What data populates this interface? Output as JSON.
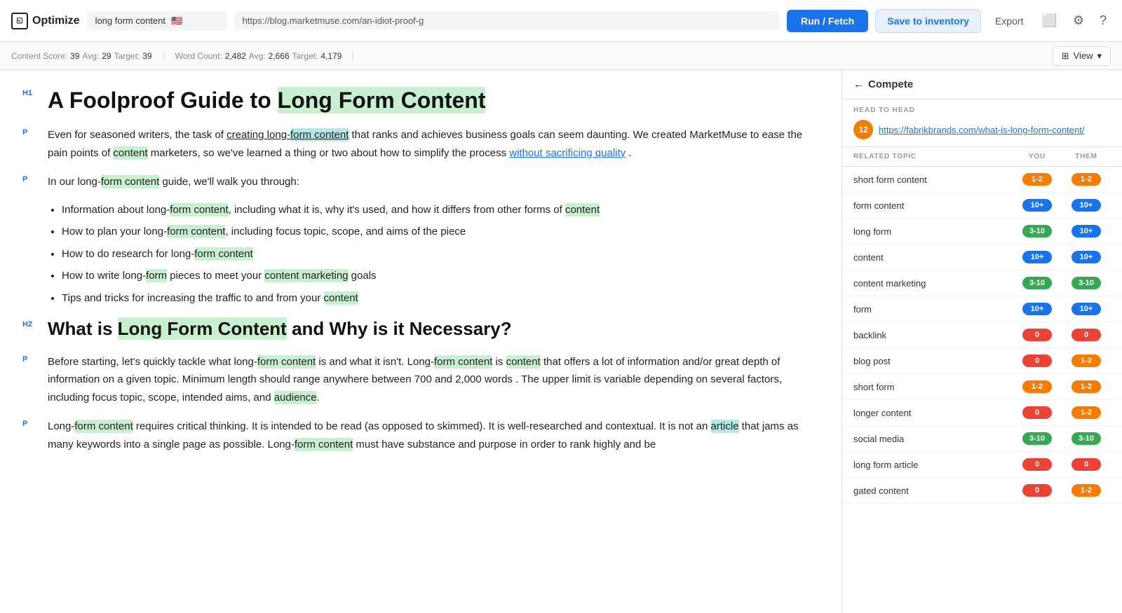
{
  "topbar": {
    "logo": "Optimize",
    "topic": "long form content",
    "flag": "🇺🇸",
    "url": "https://blog.marketmuse.com/an-idiot-proof-g",
    "run_label": "Run / Fetch",
    "save_label": "Save to inventory",
    "export_label": "Export"
  },
  "statsbar": {
    "content_score_label": "Content Score:",
    "content_score_value": "39",
    "avg_label": "Avg:",
    "avg_value": "29",
    "target_label": "Target:",
    "target_value": "39",
    "word_count_label": "Word Count:",
    "word_count_value": "2,482",
    "word_avg_label": "Avg:",
    "word_avg_value": "2,666",
    "word_target_label": "Target:",
    "word_target_value": "4,179",
    "view_label": "View"
  },
  "article": {
    "h1": "A Foolproof Guide to Long Form Content",
    "p1": "Even for seasoned writers, the task of creating long-form content that ranks and achieves business goals can seem daunting. We created MarketMuse to ease the pain points of content marketers, so we've learned a thing or two about how to simplify the process without sacrificing quality .",
    "p2": "In our long-form content guide, we'll walk you through:",
    "bullets": [
      "Information about long-form content, including what it is, why it's used, and how it differs from other forms of content",
      "How to plan your long-form content, including focus topic, scope, and aims of the piece",
      "How to do research for long-form content",
      "How to write long-form pieces to meet your content marketing goals",
      "Tips and tricks for increasing the traffic to and from your content"
    ],
    "h2": "What is Long Form Content and Why is it Necessary?",
    "p3": "Before starting, let's quickly tackle what long-form content is and what it isn't. Long-form content is content that offers a lot of information and/or great depth of information on a given topic. Minimum length should range anywhere between 700 and 2,000 words . The upper limit is variable depending on several factors, including focus topic, scope, intended aims, and audience.",
    "p4": "Long-form content requires critical thinking. It is intended to be read (as opposed to skimmed). It is well-researched and contextual. It is not an article that jams as many keywords into a single page as possible. Long-form content must have substance and purpose in order to rank highly and be"
  },
  "sidebar": {
    "compete_label": "Compete",
    "head_to_head_label": "HEAD TO HEAD",
    "competitor_score": "12",
    "competitor_url": "https://fabrikbrands.com/what-is-long-form-content/",
    "col_topic": "RELATED TOPIC",
    "col_you": "YOU",
    "col_them": "THEM",
    "topics": [
      {
        "name": "short form content",
        "you": "1-2",
        "you_color": "orange",
        "them": "1-2",
        "them_color": "orange"
      },
      {
        "name": "form content",
        "you": "10+",
        "you_color": "blue",
        "them": "10+",
        "them_color": "blue"
      },
      {
        "name": "long form",
        "you": "3-10",
        "you_color": "green",
        "them": "10+",
        "them_color": "blue"
      },
      {
        "name": "content",
        "you": "10+",
        "you_color": "blue",
        "them": "10+",
        "them_color": "blue"
      },
      {
        "name": "content marketing",
        "you": "3-10",
        "you_color": "green",
        "them": "3-10",
        "them_color": "green"
      },
      {
        "name": "form",
        "you": "10+",
        "you_color": "blue",
        "them": "10+",
        "them_color": "blue"
      },
      {
        "name": "backlink",
        "you": "0",
        "you_color": "red",
        "them": "0",
        "them_color": "red"
      },
      {
        "name": "blog post",
        "you": "0",
        "you_color": "red",
        "them": "1-2",
        "them_color": "orange"
      },
      {
        "name": "short form",
        "you": "1-2",
        "you_color": "orange",
        "them": "1-2",
        "them_color": "orange"
      },
      {
        "name": "longer content",
        "you": "0",
        "you_color": "red",
        "them": "1-2",
        "them_color": "orange"
      },
      {
        "name": "social media",
        "you": "3-10",
        "you_color": "green",
        "them": "3-10",
        "them_color": "green"
      },
      {
        "name": "long form article",
        "you": "0",
        "you_color": "red",
        "them": "0",
        "them_color": "red"
      },
      {
        "name": "gated content",
        "you": "0",
        "you_color": "red",
        "them": "1-2",
        "them_color": "orange"
      }
    ]
  }
}
